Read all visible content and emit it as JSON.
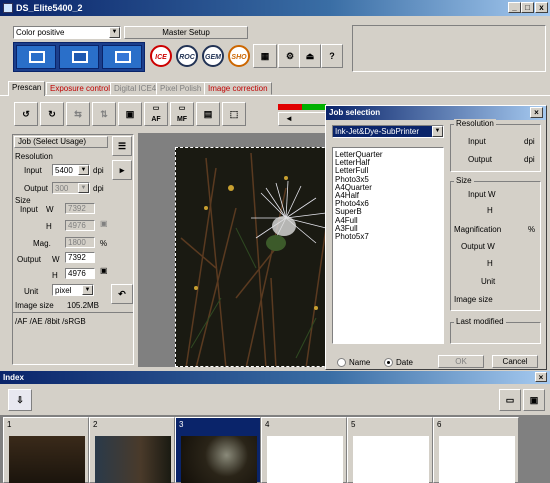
{
  "window": {
    "title": "DS_Elite5400_2"
  },
  "toolbar": {
    "color_mode": "Color positive",
    "master_setup": "Master Setup",
    "filter_buttons": [
      "ICE",
      "ROC",
      "GEM",
      "SHO"
    ],
    "help_glyph": "?"
  },
  "tabs": [
    {
      "label": "Prescan",
      "color": "#000000"
    },
    {
      "label": "Exposure control",
      "color": "#c00000"
    },
    {
      "label": "Digital ICE4",
      "color": "#808080"
    },
    {
      "label": "Pixel Polish",
      "color": "#808080"
    },
    {
      "label": "Image correction",
      "color": "#c00000"
    }
  ],
  "job_panel": {
    "header": "Job (Select Usage)",
    "resolution_label": "Resolution",
    "input_label": "Input",
    "input_value": "5400",
    "output_label": "Output",
    "output_value": "300",
    "dpi": "dpi",
    "size_label": "Size",
    "input_w_label": "Input",
    "w": "W",
    "h": "H",
    "input_w": "7392",
    "input_h": "4976",
    "mag_label": "Mag.",
    "mag_value": "1800",
    "percent": "%",
    "output_w_label": "Output",
    "output_w": "7392",
    "output_h": "4976",
    "unit_label": "Unit",
    "unit_value": "pixel",
    "image_size_label": "Image size",
    "image_size_value": "105.2MB",
    "status": "/AF /AE /8bit /sRGB"
  },
  "preview_tools": [
    "AF",
    "MF"
  ],
  "job_dialog": {
    "title": "Job selection",
    "category": "Ink-Jet&Dye-SubPrinter",
    "items": [
      "LetterQuarter",
      "LetterHalf",
      "LetterFull",
      "Photo3x5",
      "A4Quarter",
      "A4Half",
      "Photo4x6",
      "SuperB",
      "A4Full",
      "A3Full",
      "Photo5x7"
    ],
    "resolution_group": "Resolution",
    "input": "Input",
    "output": "Output",
    "dpi": "dpi",
    "size_group": "Size",
    "input_w": "Input W",
    "h": "H",
    "magnification": "Magnification",
    "percent": "%",
    "output_w": "Output W",
    "unit": "Unit",
    "image_size": "Image size",
    "last_modified": "Last modified",
    "sort_name": "Name",
    "sort_date": "Date",
    "ok": "OK",
    "cancel": "Cancel",
    "close_glyph": "×"
  },
  "index_window": {
    "title": "Index",
    "close_glyph": "×",
    "frames": [
      "1",
      "2",
      "3",
      "4",
      "5",
      "6"
    ],
    "selected_frame": "3"
  }
}
